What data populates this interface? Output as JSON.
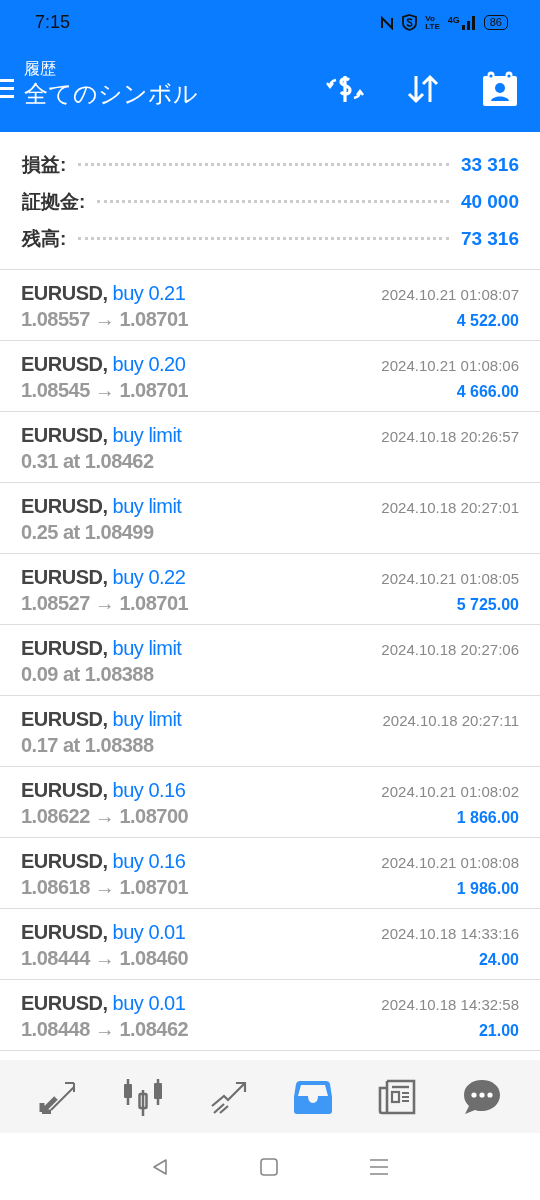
{
  "status_bar": {
    "time": "7:15",
    "volte": [
      "Vo",
      "LTE"
    ],
    "network": "4G",
    "battery": "86"
  },
  "header": {
    "subtitle": "履歴",
    "title": "全てのシンボル"
  },
  "summary": [
    {
      "label": "損益:",
      "value": "33 316"
    },
    {
      "label": "証拠金:",
      "value": "40 000"
    },
    {
      "label": "残高:",
      "value": "73 316"
    }
  ],
  "rows": [
    {
      "symbol": "EURUSD,",
      "order": "buy 0.21",
      "detail": "1.08557 → 1.08701",
      "time": "2024.10.21 01:08:07",
      "profit": "4 522.00"
    },
    {
      "symbol": "EURUSD,",
      "order": "buy 0.20",
      "detail": "1.08545 → 1.08701",
      "time": "2024.10.21 01:08:06",
      "profit": "4 666.00"
    },
    {
      "symbol": "EURUSD,",
      "order": "buy limit",
      "detail": "0.31 at 1.08462",
      "time": "2024.10.18 20:26:57"
    },
    {
      "symbol": "EURUSD,",
      "order": "buy limit",
      "detail": "0.25 at 1.08499",
      "time": "2024.10.18 20:27:01"
    },
    {
      "symbol": "EURUSD,",
      "order": "buy 0.22",
      "detail": "1.08527 → 1.08701",
      "time": "2024.10.21 01:08:05",
      "profit": "5 725.00"
    },
    {
      "symbol": "EURUSD,",
      "order": "buy limit",
      "detail": "0.09 at 1.08388",
      "time": "2024.10.18 20:27:06"
    },
    {
      "symbol": "EURUSD,",
      "order": "buy limit",
      "detail": "0.17 at 1.08388",
      "time": "2024.10.18 20:27:11"
    },
    {
      "symbol": "EURUSD,",
      "order": "buy 0.16",
      "detail": "1.08622 → 1.08700",
      "time": "2024.10.21 01:08:02",
      "profit": "1 866.00"
    },
    {
      "symbol": "EURUSD,",
      "order": "buy 0.16",
      "detail": "1.08618 → 1.08701",
      "time": "2024.10.21 01:08:08",
      "profit": "1 986.00"
    },
    {
      "symbol": "EURUSD,",
      "order": "buy 0.01",
      "detail": "1.08444 → 1.08460",
      "time": "2024.10.18 14:33:16",
      "profit": "24.00"
    },
    {
      "symbol": "EURUSD,",
      "order": "buy 0.01",
      "detail": "1.08448 → 1.08462",
      "time": "2024.10.18 14:32:58",
      "profit": "21.00"
    }
  ],
  "nav": [
    {
      "kind": "trade",
      "selected": false
    },
    {
      "kind": "chart",
      "selected": false
    },
    {
      "kind": "trend",
      "selected": false
    },
    {
      "kind": "history",
      "selected": true
    },
    {
      "kind": "news",
      "selected": false
    },
    {
      "kind": "chat",
      "selected": false
    }
  ]
}
